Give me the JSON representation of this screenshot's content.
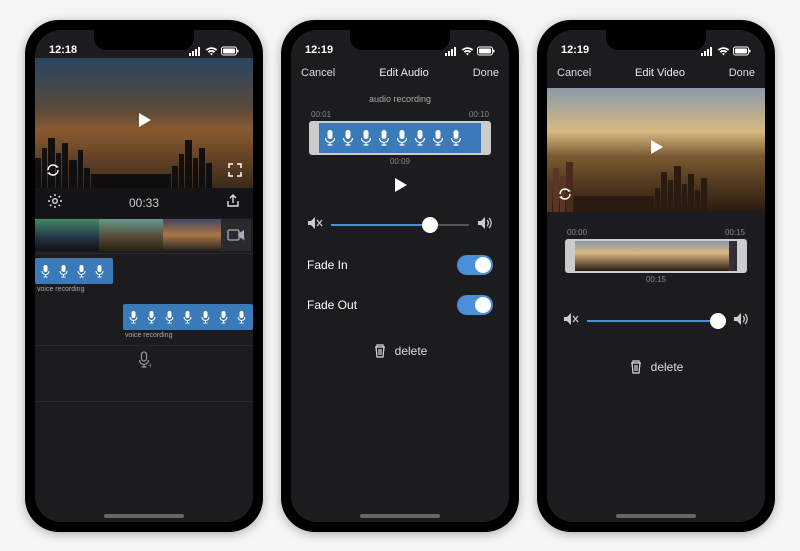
{
  "screen1": {
    "status": {
      "time": "12:18"
    },
    "preview": {
      "duration": "00:33"
    },
    "tracks": {
      "label1": "voice recording",
      "label2": "voice recording"
    }
  },
  "screen2": {
    "status": {
      "time": "12:19"
    },
    "nav": {
      "cancel": "Cancel",
      "title": "Edit Audio",
      "done": "Done"
    },
    "subtitle": "audio recording",
    "trim": {
      "start": "00:01",
      "end": "00:10",
      "current": "00:09"
    },
    "volume": {
      "value": 0.72
    },
    "fadeIn": {
      "label": "Fade In",
      "on": true
    },
    "fadeOut": {
      "label": "Fade Out",
      "on": true
    },
    "delete": "delete"
  },
  "screen3": {
    "status": {
      "time": "12:19"
    },
    "nav": {
      "cancel": "Cancel",
      "title": "Edit Video",
      "done": "Done"
    },
    "trim": {
      "start": "00:00",
      "end": "00:15",
      "current": "00:15"
    },
    "volume": {
      "value": 0.95
    },
    "delete": "delete"
  }
}
